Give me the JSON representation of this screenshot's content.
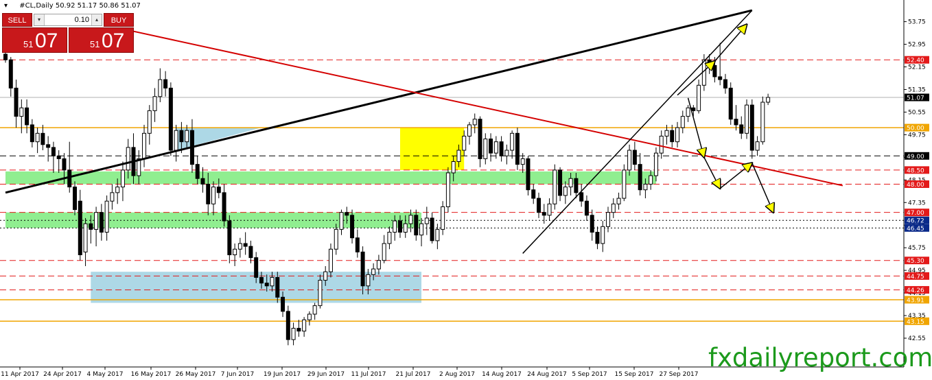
{
  "header": {
    "symbol": "#CL,Daily",
    "ohlc": "50.92 51.17 50.86 51.07"
  },
  "trade_panel": {
    "sell_label": "SELL",
    "buy_label": "BUY",
    "quantity": "0.10",
    "down_arrow": "▾",
    "up_arrow": "▴",
    "sell_price_small": "51",
    "sell_price_big": "07",
    "buy_price_small": "51",
    "buy_price_big": "07"
  },
  "watermark": "fxdailyreport.com",
  "colors": {
    "candle_bull": "#ffffff",
    "candle_bear": "#000000",
    "red_dash": "#e31a1a",
    "orange_line": "#f0a500",
    "green_zone": "#90ee90",
    "blue_zone": "#add8e6",
    "yellow_zone": "#ffff00",
    "trend_red": "#d40000",
    "label_red": "#e31a1a",
    "label_blue": "#0a2a8a",
    "label_black": "#000000",
    "label_orange": "#f0a500",
    "brand_green": "#1c9a1c"
  },
  "chart_data": {
    "type": "candlestick",
    "yaxis_ticks": [
      "53.75",
      "52.95",
      "52.15",
      "51.35",
      "50.55",
      "49.75",
      "48.95",
      "48.15",
      "47.35",
      "46.55",
      "45.75",
      "44.95",
      "44.15",
      "43.35",
      "42.55"
    ],
    "xaxis_ticks": [
      "11 Apr 2017",
      "24 Apr 2017",
      "4 May 2017",
      "16 May 2017",
      "26 May 2017",
      "7 Jun 2017",
      "19 Jun 2017",
      "29 Jun 2017",
      "11 Jul 2017",
      "21 Jul 2017",
      "2 Aug 2017",
      "14 Aug 2017",
      "24 Aug 2017",
      "5 Sep 2017",
      "15 Sep 2017",
      "27 Sep 2017"
    ],
    "price_labels": [
      {
        "price": 52.4,
        "text": "52.40",
        "style": "red"
      },
      {
        "price": 51.07,
        "text": "51.07",
        "style": "black"
      },
      {
        "price": 50.0,
        "text": "50.00",
        "style": "orange"
      },
      {
        "price": 49.0,
        "text": "49.00",
        "style": "black"
      },
      {
        "price": 48.5,
        "text": "48.50",
        "style": "red"
      },
      {
        "price": 48.0,
        "text": "48.00",
        "style": "red"
      },
      {
        "price": 47.0,
        "text": "47.00",
        "style": "red"
      },
      {
        "price": 46.72,
        "text": "46.72",
        "style": "blue"
      },
      {
        "price": 46.45,
        "text": "46.45",
        "style": "blue"
      },
      {
        "price": 45.3,
        "text": "45.30",
        "style": "red"
      },
      {
        "price": 44.75,
        "text": "44.75",
        "style": "red"
      },
      {
        "price": 44.26,
        "text": "44.26",
        "style": "red"
      },
      {
        "price": 43.91,
        "text": "43.91",
        "style": "orange"
      },
      {
        "price": 43.15,
        "text": "43.15",
        "style": "orange"
      }
    ],
    "levels": [
      {
        "price": 52.4,
        "style": "red-dash"
      },
      {
        "price": 51.07,
        "style": "gray-solid"
      },
      {
        "price": 50.0,
        "style": "orange-solid"
      },
      {
        "price": 49.0,
        "style": "black-dash"
      },
      {
        "price": 48.5,
        "style": "red-dash"
      },
      {
        "price": 48.0,
        "style": "red-dash"
      },
      {
        "price": 47.0,
        "style": "red-dash"
      },
      {
        "price": 46.72,
        "style": "black-dot"
      },
      {
        "price": 46.45,
        "style": "black-dot"
      },
      {
        "price": 45.3,
        "style": "red-dash"
      },
      {
        "price": 44.75,
        "style": "red-dash"
      },
      {
        "price": 44.26,
        "style": "red-dash"
      },
      {
        "price": 43.91,
        "style": "orange-solid"
      },
      {
        "price": 43.15,
        "style": "orange-solid"
      }
    ],
    "zones": [
      {
        "color": "green",
        "from_bar": 0,
        "to_bar": 122,
        "low": 48.0,
        "high": 48.45
      },
      {
        "color": "green",
        "from_bar": 0,
        "to_bar": 78,
        "low": 46.45,
        "high": 47.0
      },
      {
        "color": "blue",
        "from_bar": 16,
        "to_bar": 78,
        "low": 43.8,
        "high": 44.9
      },
      {
        "color": "yellow",
        "from_bar": 74,
        "to_bar": 86,
        "low": 48.5,
        "high": 50.0
      }
    ],
    "trendlines": [
      {
        "from": [
          0,
          47.7
        ],
        "to": [
          140,
          54.15
        ],
        "color": "black",
        "width": 3
      },
      {
        "from": [
          23,
          53.45
        ],
        "to": [
          157,
          47.95
        ],
        "color": "red",
        "width": 2
      },
      {
        "from": [
          97,
          45.55
        ],
        "to": [
          140,
          54.15
        ],
        "color": "black",
        "width": 1.5
      }
    ],
    "projection_arrows": [
      {
        "from": [
          126,
          51.15
        ],
        "to": [
          133,
          52.35
        ]
      },
      {
        "from": [
          133,
          52.35
        ],
        "to": [
          139,
          53.65
        ]
      },
      {
        "from": [
          128,
          51.05
        ],
        "to": [
          131,
          48.95
        ]
      },
      {
        "from": [
          131,
          48.95
        ],
        "to": [
          134,
          47.85
        ]
      },
      {
        "from": [
          134,
          47.85
        ],
        "to": [
          140,
          48.75
        ]
      },
      {
        "from": [
          140,
          48.75
        ],
        "to": [
          144,
          47.0
        ]
      }
    ],
    "candles": [
      {
        "o": 52.6,
        "h": 53.1,
        "l": 52.3,
        "c": 52.4
      },
      {
        "o": 52.4,
        "h": 52.5,
        "l": 51.1,
        "c": 51.4
      },
      {
        "o": 51.4,
        "h": 51.7,
        "l": 50.0,
        "c": 50.4
      },
      {
        "o": 50.4,
        "h": 51.0,
        "l": 49.8,
        "c": 50.7
      },
      {
        "o": 50.7,
        "h": 51.0,
        "l": 49.8,
        "c": 50.1
      },
      {
        "o": 50.1,
        "h": 50.3,
        "l": 49.3,
        "c": 49.5
      },
      {
        "o": 49.5,
        "h": 50.0,
        "l": 49.1,
        "c": 49.8
      },
      {
        "o": 49.8,
        "h": 50.1,
        "l": 49.2,
        "c": 49.4
      },
      {
        "o": 49.4,
        "h": 49.7,
        "l": 48.8,
        "c": 49.3
      },
      {
        "o": 49.3,
        "h": 49.5,
        "l": 48.4,
        "c": 49.0
      },
      {
        "o": 49.0,
        "h": 49.2,
        "l": 48.4,
        "c": 48.9
      },
      {
        "o": 48.9,
        "h": 49.1,
        "l": 48.0,
        "c": 48.5
      },
      {
        "o": 48.5,
        "h": 49.5,
        "l": 47.7,
        "c": 47.9
      },
      {
        "o": 47.9,
        "h": 48.1,
        "l": 46.9,
        "c": 47.1
      },
      {
        "o": 47.4,
        "h": 47.8,
        "l": 45.3,
        "c": 45.5
      },
      {
        "o": 45.6,
        "h": 46.8,
        "l": 45.1,
        "c": 46.6
      },
      {
        "o": 46.6,
        "h": 46.9,
        "l": 45.9,
        "c": 46.4
      },
      {
        "o": 46.4,
        "h": 47.2,
        "l": 45.8,
        "c": 47.0
      },
      {
        "o": 47.0,
        "h": 47.3,
        "l": 46.0,
        "c": 46.3
      },
      {
        "o": 46.3,
        "h": 47.6,
        "l": 46.0,
        "c": 47.4
      },
      {
        "o": 47.4,
        "h": 48.0,
        "l": 47.1,
        "c": 47.7
      },
      {
        "o": 47.7,
        "h": 48.2,
        "l": 47.3,
        "c": 47.9
      },
      {
        "o": 47.9,
        "h": 48.8,
        "l": 47.4,
        "c": 48.5
      },
      {
        "o": 48.5,
        "h": 49.6,
        "l": 48.2,
        "c": 49.3
      },
      {
        "o": 49.3,
        "h": 49.8,
        "l": 48.0,
        "c": 48.3
      },
      {
        "o": 48.3,
        "h": 49.2,
        "l": 48.0,
        "c": 48.9
      },
      {
        "o": 48.9,
        "h": 50.1,
        "l": 48.6,
        "c": 49.8
      },
      {
        "o": 49.8,
        "h": 50.8,
        "l": 49.4,
        "c": 50.6
      },
      {
        "o": 50.6,
        "h": 51.4,
        "l": 50.2,
        "c": 51.1
      },
      {
        "o": 51.1,
        "h": 52.1,
        "l": 50.9,
        "c": 51.7
      },
      {
        "o": 51.7,
        "h": 52.0,
        "l": 51.1,
        "c": 51.4
      },
      {
        "o": 51.4,
        "h": 51.6,
        "l": 49.0,
        "c": 49.2
      },
      {
        "o": 49.2,
        "h": 50.1,
        "l": 48.8,
        "c": 49.9
      },
      {
        "o": 49.9,
        "h": 50.2,
        "l": 49.1,
        "c": 49.5
      },
      {
        "o": 49.5,
        "h": 50.1,
        "l": 49.3,
        "c": 49.9
      },
      {
        "o": 49.9,
        "h": 50.3,
        "l": 48.4,
        "c": 48.7
      },
      {
        "o": 48.7,
        "h": 49.0,
        "l": 48.0,
        "c": 48.2
      },
      {
        "o": 48.2,
        "h": 48.6,
        "l": 47.7,
        "c": 48.0
      },
      {
        "o": 48.0,
        "h": 48.4,
        "l": 46.9,
        "c": 47.3
      },
      {
        "o": 47.3,
        "h": 48.1,
        "l": 46.9,
        "c": 47.9
      },
      {
        "o": 47.9,
        "h": 48.2,
        "l": 47.5,
        "c": 47.7
      },
      {
        "o": 47.7,
        "h": 48.0,
        "l": 46.5,
        "c": 46.7
      },
      {
        "o": 46.7,
        "h": 46.9,
        "l": 45.2,
        "c": 45.5
      },
      {
        "o": 45.5,
        "h": 45.9,
        "l": 45.1,
        "c": 45.7
      },
      {
        "o": 45.7,
        "h": 46.1,
        "l": 45.4,
        "c": 45.9
      },
      {
        "o": 45.9,
        "h": 46.3,
        "l": 45.5,
        "c": 45.8
      },
      {
        "o": 45.8,
        "h": 46.0,
        "l": 45.2,
        "c": 45.4
      },
      {
        "o": 45.4,
        "h": 45.6,
        "l": 44.5,
        "c": 44.7
      },
      {
        "o": 44.7,
        "h": 44.9,
        "l": 44.3,
        "c": 44.5
      },
      {
        "o": 44.5,
        "h": 44.8,
        "l": 44.2,
        "c": 44.4
      },
      {
        "o": 44.4,
        "h": 44.9,
        "l": 44.2,
        "c": 44.7
      },
      {
        "o": 44.7,
        "h": 44.9,
        "l": 43.8,
        "c": 44.0
      },
      {
        "o": 44.0,
        "h": 44.2,
        "l": 43.3,
        "c": 43.5
      },
      {
        "o": 43.5,
        "h": 43.7,
        "l": 42.3,
        "c": 42.5
      },
      {
        "o": 42.5,
        "h": 43.1,
        "l": 42.3,
        "c": 42.9
      },
      {
        "o": 42.9,
        "h": 43.2,
        "l": 42.6,
        "c": 42.8
      },
      {
        "o": 42.8,
        "h": 43.3,
        "l": 42.6,
        "c": 43.2
      },
      {
        "o": 43.2,
        "h": 43.5,
        "l": 43.0,
        "c": 43.4
      },
      {
        "o": 43.4,
        "h": 43.8,
        "l": 43.2,
        "c": 43.7
      },
      {
        "o": 43.7,
        "h": 44.8,
        "l": 43.6,
        "c": 44.6
      },
      {
        "o": 44.6,
        "h": 45.1,
        "l": 44.4,
        "c": 44.9
      },
      {
        "o": 44.9,
        "h": 45.9,
        "l": 44.7,
        "c": 45.7
      },
      {
        "o": 45.7,
        "h": 46.6,
        "l": 45.5,
        "c": 46.4
      },
      {
        "o": 46.4,
        "h": 47.1,
        "l": 46.2,
        "c": 47.0
      },
      {
        "o": 47.0,
        "h": 47.2,
        "l": 46.6,
        "c": 46.9
      },
      {
        "o": 46.9,
        "h": 47.1,
        "l": 45.9,
        "c": 46.1
      },
      {
        "o": 46.1,
        "h": 46.4,
        "l": 45.4,
        "c": 45.6
      },
      {
        "o": 45.6,
        "h": 45.8,
        "l": 44.1,
        "c": 44.4
      },
      {
        "o": 44.4,
        "h": 45.0,
        "l": 44.1,
        "c": 44.8
      },
      {
        "o": 44.8,
        "h": 45.2,
        "l": 44.6,
        "c": 45.0
      },
      {
        "o": 45.0,
        "h": 45.5,
        "l": 44.8,
        "c": 45.3
      },
      {
        "o": 45.3,
        "h": 46.2,
        "l": 45.2,
        "c": 45.9
      },
      {
        "o": 45.9,
        "h": 46.5,
        "l": 45.7,
        "c": 46.3
      },
      {
        "o": 46.3,
        "h": 46.9,
        "l": 46.0,
        "c": 46.7
      },
      {
        "o": 46.7,
        "h": 46.9,
        "l": 46.1,
        "c": 46.3
      },
      {
        "o": 46.3,
        "h": 46.9,
        "l": 46.1,
        "c": 46.6
      },
      {
        "o": 46.6,
        "h": 47.1,
        "l": 46.3,
        "c": 46.9
      },
      {
        "o": 46.9,
        "h": 47.1,
        "l": 46.0,
        "c": 46.2
      },
      {
        "o": 46.2,
        "h": 46.8,
        "l": 45.8,
        "c": 46.6
      },
      {
        "o": 46.6,
        "h": 47.2,
        "l": 46.2,
        "c": 46.8
      },
      {
        "o": 46.8,
        "h": 47.0,
        "l": 45.9,
        "c": 46.0
      },
      {
        "o": 46.0,
        "h": 46.6,
        "l": 45.7,
        "c": 46.4
      },
      {
        "o": 46.4,
        "h": 47.4,
        "l": 46.2,
        "c": 47.2
      },
      {
        "o": 47.2,
        "h": 48.6,
        "l": 47.0,
        "c": 48.4
      },
      {
        "o": 48.4,
        "h": 49.0,
        "l": 48.1,
        "c": 48.8
      },
      {
        "o": 48.8,
        "h": 49.4,
        "l": 48.6,
        "c": 49.2
      },
      {
        "o": 49.2,
        "h": 49.9,
        "l": 49.0,
        "c": 49.7
      },
      {
        "o": 49.7,
        "h": 50.2,
        "l": 49.4,
        "c": 50.1
      },
      {
        "o": 50.1,
        "h": 50.5,
        "l": 49.8,
        "c": 50.3
      },
      {
        "o": 50.3,
        "h": 50.4,
        "l": 48.6,
        "c": 48.9
      },
      {
        "o": 48.9,
        "h": 49.8,
        "l": 48.7,
        "c": 49.6
      },
      {
        "o": 49.6,
        "h": 49.8,
        "l": 48.8,
        "c": 49.1
      },
      {
        "o": 49.1,
        "h": 49.7,
        "l": 48.9,
        "c": 49.5
      },
      {
        "o": 49.5,
        "h": 49.7,
        "l": 48.8,
        "c": 49.0
      },
      {
        "o": 49.0,
        "h": 49.4,
        "l": 48.7,
        "c": 49.2
      },
      {
        "o": 49.2,
        "h": 49.9,
        "l": 48.9,
        "c": 49.8
      }
    ],
    "candles_tail": [
      {
        "o": 49.8,
        "h": 50.0,
        "l": 48.5,
        "c": 48.7
      },
      {
        "o": 48.7,
        "h": 49.1,
        "l": 48.4,
        "c": 48.9
      },
      {
        "o": 48.9,
        "h": 49.0,
        "l": 47.6,
        "c": 47.8
      },
      {
        "o": 47.8,
        "h": 48.0,
        "l": 47.3,
        "c": 47.5
      },
      {
        "o": 47.5,
        "h": 47.7,
        "l": 46.8,
        "c": 47.0
      },
      {
        "o": 47.0,
        "h": 47.3,
        "l": 46.6,
        "c": 46.9
      },
      {
        "o": 46.9,
        "h": 47.5,
        "l": 46.7,
        "c": 47.3
      },
      {
        "o": 47.3,
        "h": 48.7,
        "l": 47.1,
        "c": 48.5
      },
      {
        "o": 48.5,
        "h": 48.6,
        "l": 47.4,
        "c": 47.6
      },
      {
        "o": 47.6,
        "h": 48.1,
        "l": 47.3,
        "c": 47.9
      },
      {
        "o": 47.9,
        "h": 48.4,
        "l": 47.6,
        "c": 48.2
      },
      {
        "o": 48.2,
        "h": 48.4,
        "l": 47.5,
        "c": 47.7
      },
      {
        "o": 47.7,
        "h": 48.0,
        "l": 47.2,
        "c": 47.4
      },
      {
        "o": 47.4,
        "h": 47.6,
        "l": 46.7,
        "c": 46.9
      },
      {
        "o": 46.9,
        "h": 47.1,
        "l": 46.0,
        "c": 46.3
      },
      {
        "o": 46.3,
        "h": 46.5,
        "l": 45.7,
        "c": 45.9
      },
      {
        "o": 45.9,
        "h": 46.7,
        "l": 45.6,
        "c": 46.5
      },
      {
        "o": 46.5,
        "h": 47.2,
        "l": 46.3,
        "c": 47.0
      },
      {
        "o": 47.0,
        "h": 47.5,
        "l": 46.8,
        "c": 47.3
      },
      {
        "o": 47.3,
        "h": 47.7,
        "l": 47.1,
        "c": 47.5
      },
      {
        "o": 47.5,
        "h": 48.7,
        "l": 47.4,
        "c": 48.5
      },
      {
        "o": 48.5,
        "h": 49.4,
        "l": 48.3,
        "c": 49.2
      },
      {
        "o": 49.2,
        "h": 49.5,
        "l": 48.5,
        "c": 48.7
      },
      {
        "o": 48.7,
        "h": 49.1,
        "l": 47.6,
        "c": 47.8
      },
      {
        "o": 47.8,
        "h": 48.2,
        "l": 47.5,
        "c": 48.0
      },
      {
        "o": 48.0,
        "h": 48.5,
        "l": 47.8,
        "c": 48.3
      },
      {
        "o": 48.3,
        "h": 49.3,
        "l": 48.1,
        "c": 49.1
      },
      {
        "o": 49.1,
        "h": 49.9,
        "l": 48.9,
        "c": 49.7
      },
      {
        "o": 49.7,
        "h": 50.1,
        "l": 49.4,
        "c": 49.9
      },
      {
        "o": 49.9,
        "h": 50.1,
        "l": 49.3,
        "c": 49.5
      },
      {
        "o": 49.5,
        "h": 50.2,
        "l": 49.3,
        "c": 50.0
      },
      {
        "o": 50.0,
        "h": 50.6,
        "l": 49.8,
        "c": 50.4
      },
      {
        "o": 50.4,
        "h": 50.8,
        "l": 50.2,
        "c": 50.7
      },
      {
        "o": 50.7,
        "h": 50.8,
        "l": 50.4,
        "c": 50.6
      },
      {
        "o": 50.6,
        "h": 51.7,
        "l": 50.5,
        "c": 51.5
      },
      {
        "o": 51.5,
        "h": 52.6,
        "l": 51.3,
        "c": 52.4
      },
      {
        "o": 52.4,
        "h": 52.6,
        "l": 51.9,
        "c": 52.2
      },
      {
        "o": 52.2,
        "h": 52.5,
        "l": 51.6,
        "c": 51.8
      },
      {
        "o": 51.8,
        "h": 53.0,
        "l": 51.5,
        "c": 51.7
      },
      {
        "o": 51.7,
        "h": 51.9,
        "l": 51.2,
        "c": 51.4
      },
      {
        "o": 51.4,
        "h": 51.6,
        "l": 50.1,
        "c": 50.3
      },
      {
        "o": 50.3,
        "h": 50.8,
        "l": 49.9,
        "c": 50.1
      },
      {
        "o": 50.1,
        "h": 50.4,
        "l": 49.6,
        "c": 49.8
      },
      {
        "o": 49.8,
        "h": 51.0,
        "l": 49.6,
        "c": 50.8
      },
      {
        "o": 50.8,
        "h": 51.0,
        "l": 48.9,
        "c": 49.2
      },
      {
        "o": 49.2,
        "h": 49.7,
        "l": 49.0,
        "c": 49.5
      },
      {
        "o": 49.5,
        "h": 51.1,
        "l": 49.4,
        "c": 50.9
      },
      {
        "o": 50.9,
        "h": 51.2,
        "l": 50.8,
        "c": 51.07
      }
    ]
  }
}
